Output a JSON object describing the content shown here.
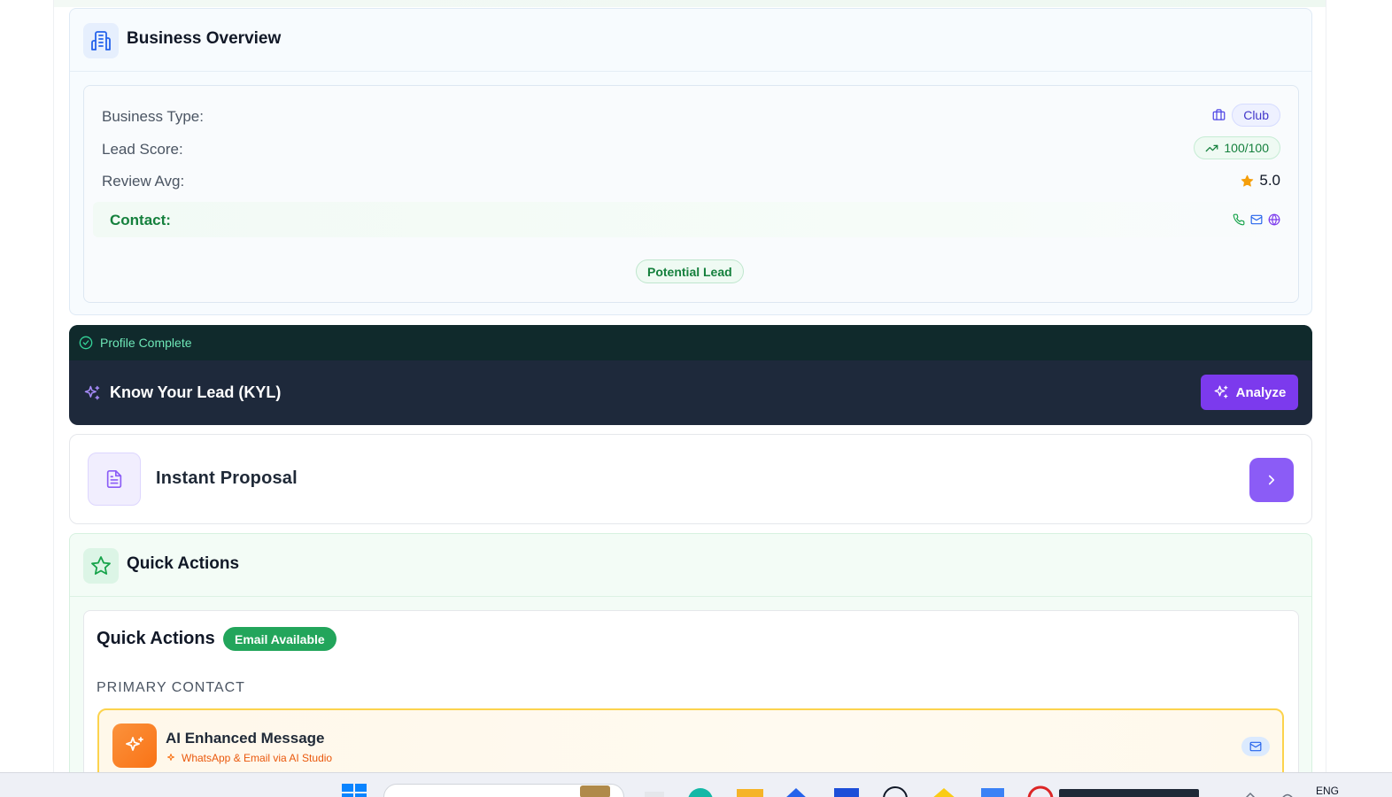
{
  "business_overview": {
    "title": "Business Overview",
    "icon": "building-icon",
    "business_type_label": "Business Type:",
    "business_type_value": "Club",
    "lead_score_label": "Lead Score:",
    "lead_score_value": "100/100",
    "review_avg_label": "Review Avg:",
    "review_avg_value": "5.0",
    "contact_label": "Contact:",
    "contact_icons": [
      "phone-icon",
      "mail-icon",
      "globe-icon"
    ],
    "lead_status": "Potential Lead"
  },
  "kyl": {
    "status": "Profile Complete",
    "title": "Know Your Lead (KYL)",
    "analyze_label": "Analyze"
  },
  "proposal": {
    "title": "Instant Proposal"
  },
  "quick_actions": {
    "title": "Quick Actions",
    "inner_title": "Quick Actions",
    "email_badge": "Email Available",
    "primary_contact_label": "PRIMARY CONTACT",
    "ai_message": {
      "title": "AI Enhanced Message",
      "subtitle": "WhatsApp & Email via AI Studio"
    }
  },
  "taskbar": {
    "language": "ENG"
  },
  "colors": {
    "accent_purple": "#7c3aed",
    "success_green": "#22a55b",
    "dark_panel": "#1e293b",
    "warning_orange": "#f97316"
  }
}
